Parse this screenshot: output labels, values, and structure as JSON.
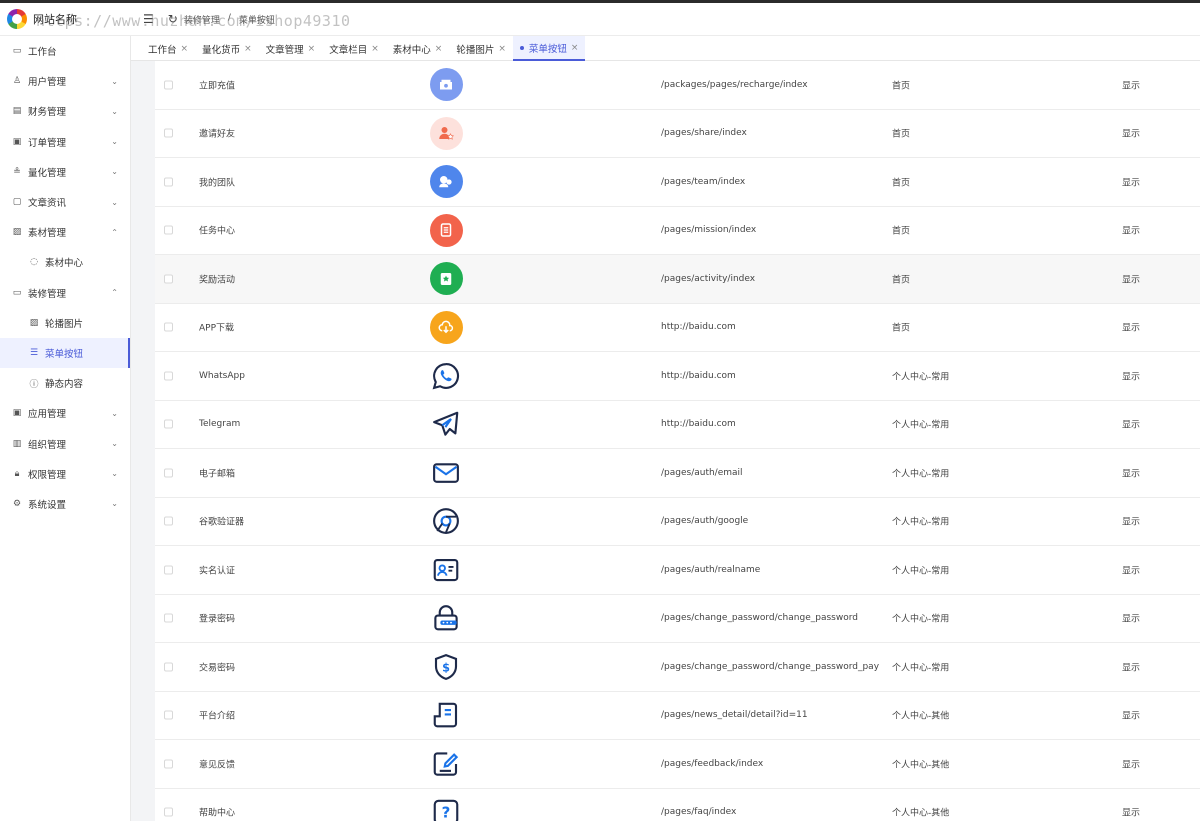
{
  "header": {
    "site_name": "网站名称",
    "breadcrumbs": [
      "装修管理",
      "/",
      "菜单按钮"
    ],
    "watermark": "https://www.huzhan.com/ishop49310"
  },
  "sidebar": {
    "items": [
      {
        "label": "工作台",
        "icon": "monitor-icon"
      },
      {
        "label": "用户管理",
        "icon": "user-icon",
        "expandable": true
      },
      {
        "label": "财务管理",
        "icon": "chart-icon",
        "expandable": true
      },
      {
        "label": "订单管理",
        "icon": "order-icon",
        "expandable": true
      },
      {
        "label": "量化管理",
        "icon": "quant-icon",
        "expandable": true
      },
      {
        "label": "文章资讯",
        "icon": "article-icon",
        "expandable": true
      },
      {
        "label": "素材管理",
        "icon": "image-icon",
        "expanded": true
      },
      {
        "label": "素材中心",
        "icon": "circle-icon",
        "sub": true
      },
      {
        "label": "装修管理",
        "icon": "decorate-icon",
        "expanded": true
      },
      {
        "label": "轮播图片",
        "icon": "picture-icon",
        "sub": true
      },
      {
        "label": "菜单按钮",
        "icon": "list-icon",
        "sub": true,
        "active": true
      },
      {
        "label": "静态内容",
        "icon": "info-icon",
        "sub": true
      },
      {
        "label": "应用管理",
        "icon": "app-icon",
        "expandable": true
      },
      {
        "label": "组织管理",
        "icon": "building-icon",
        "expandable": true
      },
      {
        "label": "权限管理",
        "icon": "lock-icon",
        "expandable": true
      },
      {
        "label": "系统设置",
        "icon": "gear-icon",
        "expandable": true
      }
    ]
  },
  "tabs": [
    {
      "label": "工作台"
    },
    {
      "label": "量化货币"
    },
    {
      "label": "文章管理"
    },
    {
      "label": "文章栏目"
    },
    {
      "label": "素材中心"
    },
    {
      "label": "轮播图片"
    },
    {
      "label": "菜单按钮",
      "active": true
    }
  ],
  "colors": {
    "accent": "#4a5bd8"
  },
  "rows": [
    {
      "name": "立即充值",
      "icon": "recharge-icon",
      "icon_bg": "#7d9cf0",
      "path": "/packages/pages/recharge/index",
      "position": "首页",
      "state": "显示"
    },
    {
      "name": "邀请好友",
      "icon": "invite-icon",
      "icon_bg": "#fde1dc",
      "path": "/pages/share/index",
      "position": "首页",
      "state": "显示"
    },
    {
      "name": "我的团队",
      "icon": "team-icon",
      "icon_bg": "#4f86ec",
      "path": "/pages/team/index",
      "position": "首页",
      "state": "显示"
    },
    {
      "name": "任务中心",
      "icon": "mission-icon",
      "icon_bg": "#f2634b",
      "path": "/pages/mission/index",
      "position": "首页",
      "state": "显示"
    },
    {
      "name": "奖励活动",
      "icon": "activity-icon",
      "icon_bg": "#1fae52",
      "path": "/pages/activity/index",
      "position": "首页",
      "state": "显示"
    },
    {
      "name": "APP下载",
      "icon": "download-icon",
      "icon_bg": "#f7a51c",
      "path": "http://baidu.com",
      "position": "首页",
      "state": "显示"
    },
    {
      "name": "WhatsApp",
      "icon": "whatsapp-icon",
      "path": "http://baidu.com",
      "position": "个人中心-常用",
      "state": "显示"
    },
    {
      "name": "Telegram",
      "icon": "telegram-icon",
      "path": "http://baidu.com",
      "position": "个人中心-常用",
      "state": "显示"
    },
    {
      "name": "电子邮箱",
      "icon": "email-icon",
      "path": "/pages/auth/email",
      "position": "个人中心-常用",
      "state": "显示"
    },
    {
      "name": "谷歌验证器",
      "icon": "google-icon",
      "path": "/pages/auth/google",
      "position": "个人中心-常用",
      "state": "显示"
    },
    {
      "name": "实名认证",
      "icon": "id-card-icon",
      "path": "/pages/auth/realname",
      "position": "个人中心-常用",
      "state": "显示"
    },
    {
      "name": "登录密码",
      "icon": "password-icon",
      "path": "/pages/change_password/change_password",
      "position": "个人中心-常用",
      "state": "显示"
    },
    {
      "name": "交易密码",
      "icon": "shield-dollar-icon",
      "path": "/pages/change_password/change_password_pay",
      "position": "个人中心-常用",
      "state": "显示"
    },
    {
      "name": "平台介绍",
      "icon": "document-icon",
      "path": "/pages/news_detail/detail?id=11",
      "position": "个人中心-其他",
      "state": "显示"
    },
    {
      "name": "意见反馈",
      "icon": "feedback-icon",
      "path": "/pages/feedback/index",
      "position": "个人中心-其他",
      "state": "显示"
    },
    {
      "name": "帮助中心",
      "icon": "help-icon",
      "path": "/pages/faq/index",
      "position": "个人中心-其他",
      "state": "显示"
    }
  ]
}
